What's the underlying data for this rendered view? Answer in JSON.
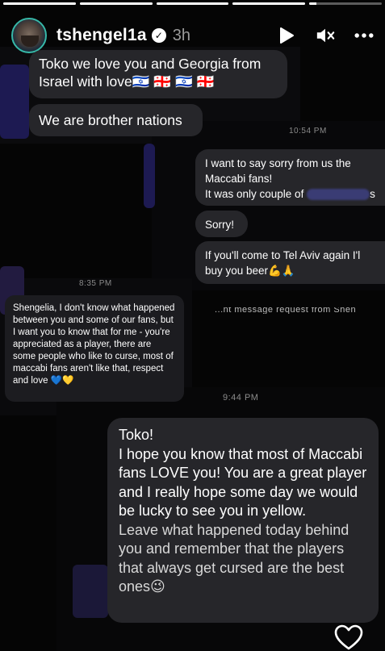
{
  "story": {
    "username": "tshengel1a",
    "time": "3h",
    "progress": [
      1,
      1,
      1,
      1,
      0.1
    ]
  },
  "messages": {
    "m1": "Toko we love you and Georgia from Israel with love🇮🇱 🇬🇪 🇮🇱 🇬🇪",
    "m2": "We are brother nations",
    "ts1": "10:54 PM",
    "m3_line1": "I want to say sorry from us the Maccabi fans!",
    "m3_line2": "It was only couple of",
    "m3_tail": "s",
    "m4": "Sorry!",
    "m5": "If you'll come to Tel Aviv again I'l buy you beer💪🙏",
    "ts2": "8:35 PM",
    "m6": "Shengelia, I don't know what happened between you and some of our fans, but I want you to know that for me - you're appreciated as a player, there are some people who like to curse, most of maccabi fans aren't like that, respect and love 💙💛",
    "partial": "...nt message request from Shen",
    "ts3": "9:44 PM",
    "m7_p1": "Toko!",
    "m7_p2": "I hope you know that most of Maccabi fans LOVE you! You are a great player and I really hope some day we would be lucky to see you in yellow.",
    "m7_p3": "Leave what happened today behind you and remember that the players that always get cursed are the best ones😉"
  },
  "icons": {
    "play": "play-icon",
    "mute": "mute-icon",
    "more": "more-options-icon",
    "like": "heart-icon",
    "verified": "verified-badge-icon"
  },
  "colors": {
    "bubble": "#26262a",
    "accent_purple": "#1d1a52",
    "avatar_ring": "#37b8a8"
  }
}
